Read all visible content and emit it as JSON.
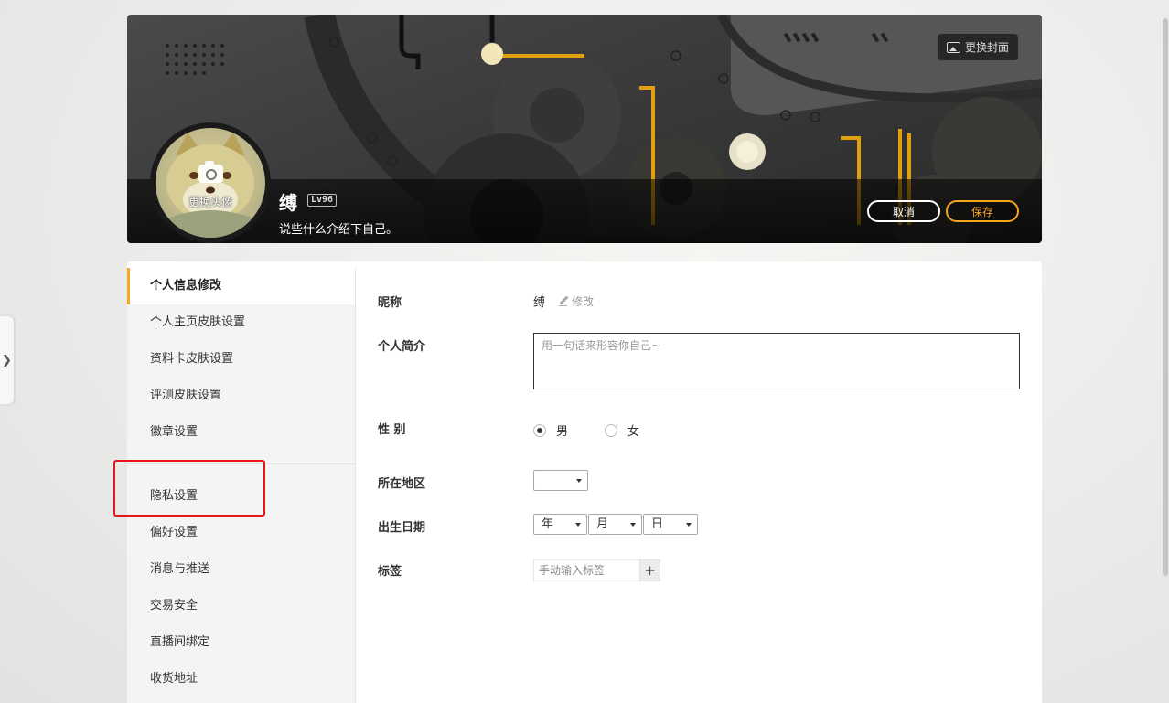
{
  "banner": {
    "change_cover_label": "更换封面",
    "change_avatar_label": "更换头像",
    "username": "缚",
    "level": "Lv96",
    "bio": "说些什么介绍下自己。",
    "cancel_label": "取消",
    "save_label": "保存"
  },
  "sidebar": {
    "items": [
      {
        "label": "个人信息修改",
        "active": true
      },
      {
        "label": "个人主页皮肤设置"
      },
      {
        "label": "资料卡皮肤设置"
      },
      {
        "label": "评测皮肤设置"
      },
      {
        "label": "徽章设置"
      },
      {
        "label": "隐私设置"
      },
      {
        "label": "偏好设置"
      },
      {
        "label": "消息与推送"
      },
      {
        "label": "交易安全"
      },
      {
        "label": "直播间绑定"
      },
      {
        "label": "收货地址"
      }
    ]
  },
  "form": {
    "nickname_label": "昵称",
    "nickname_value": "缚",
    "edit_label": "修改",
    "bio_label": "个人简介",
    "bio_placeholder": "用一句话来形容你自己~",
    "gender_label": "性 别",
    "gender_male": "男",
    "gender_female": "女",
    "gender_selected": "male",
    "region_label": "所在地区",
    "region_value": "",
    "birthday_label": "出生日期",
    "birthday_year": "年",
    "birthday_month": "月",
    "birthday_day": "日",
    "tags_label": "标签",
    "tags_placeholder": "手动输入标签",
    "tags_add": "+"
  },
  "colors": {
    "accent": "#f5a623",
    "highlight_box": "#e5151a"
  },
  "icons": {
    "side_tab": "❯"
  }
}
